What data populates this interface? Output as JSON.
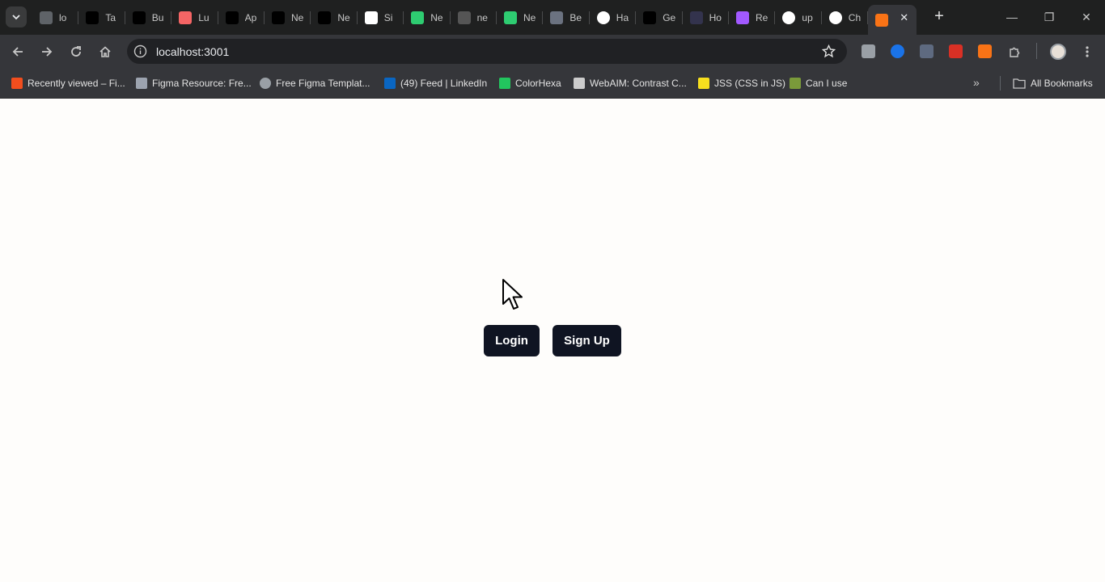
{
  "browser": {
    "tabs": [
      {
        "title": "lo",
        "icon": "globe-icon",
        "color": "#5f6368"
      },
      {
        "title": "Ta",
        "icon": "tailwind-icon",
        "color": "#000000"
      },
      {
        "title": "Bu",
        "icon": "bun-icon",
        "color": "#000000"
      },
      {
        "title": "Lu",
        "icon": "lucide-icon",
        "color": "#f56565"
      },
      {
        "title": "Ap",
        "icon": "kinde-icon",
        "color": "#000000"
      },
      {
        "title": "Ne",
        "icon": "kinde-icon",
        "color": "#000000"
      },
      {
        "title": "Ne",
        "icon": "kinde-icon",
        "color": "#000000"
      },
      {
        "title": "Si",
        "icon": "kinde-k-icon",
        "color": "#ffffff"
      },
      {
        "title": "Ne",
        "icon": "nodemon-icon",
        "color": "#2ecc71"
      },
      {
        "title": "ne",
        "icon": "nodemon-icon",
        "color": "#555555"
      },
      {
        "title": "Ne",
        "icon": "nodemon-icon",
        "color": "#2ecc71"
      },
      {
        "title": "Be",
        "icon": "drizzle-icon",
        "color": "#6b7280"
      },
      {
        "title": "Ha",
        "icon": "github-icon",
        "color": "#ffffff"
      },
      {
        "title": "Ge",
        "icon": "nextjs-icon",
        "color": "#000000"
      },
      {
        "title": "Ho",
        "icon": "appwrite-icon",
        "color": "#33334d"
      },
      {
        "title": "Re",
        "icon": "figma-icon",
        "color": "#a259ff"
      },
      {
        "title": "up",
        "icon": "google-icon",
        "color": "#ffffff"
      },
      {
        "title": "Ch",
        "icon": "chatgpt-icon",
        "color": "#ffffff"
      },
      {
        "title": "",
        "icon": "page-icon",
        "color": "#f97316",
        "active": true
      }
    ],
    "url": "localhost:3001",
    "bookmarks": [
      {
        "label": "Recently viewed – Fi...",
        "icon": "figma-icon",
        "color": "#f24e1e"
      },
      {
        "label": "Figma Resource: Fre...",
        "icon": "resource-icon",
        "color": "#9ca3af"
      },
      {
        "label": "Free Figma Templat...",
        "icon": "globe-icon",
        "color": "#9aa0a6"
      },
      {
        "label": "(49) Feed | LinkedIn",
        "icon": "linkedin-icon",
        "color": "#0a66c2"
      },
      {
        "label": "ColorHexa",
        "icon": "colorhexa-icon",
        "color": "#22c55e"
      },
      {
        "label": "WebAIM: Contrast C...",
        "icon": "webaim-icon",
        "color": "#cccccc"
      },
      {
        "label": "JSS (CSS in JS)",
        "icon": "jss-icon",
        "color": "#f7df1e"
      },
      {
        "label": "Can I use",
        "icon": "caniuse-icon",
        "color": "#7a9a3a"
      }
    ],
    "all_bookmarks_label": "All Bookmarks"
  },
  "page": {
    "login_label": "Login",
    "signup_label": "Sign Up",
    "button_color": "#0f1422",
    "background": "#fefdfb"
  }
}
